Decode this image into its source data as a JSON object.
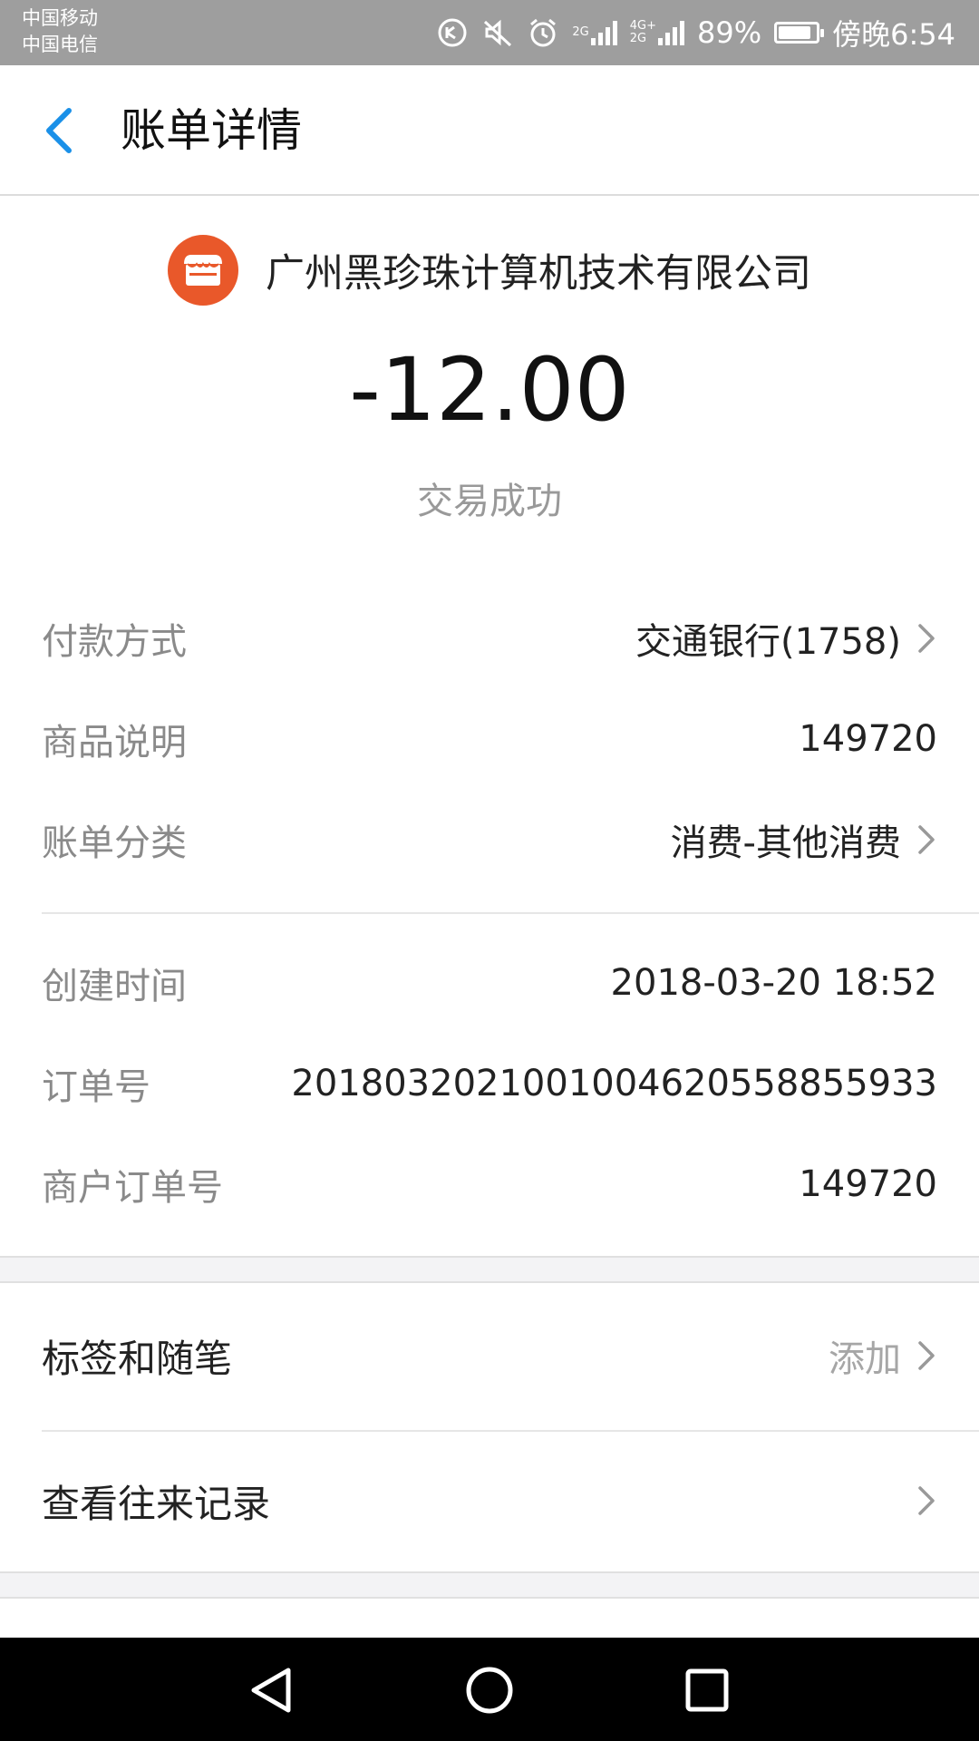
{
  "status_bar": {
    "carrier1": "中国移动",
    "carrier2": "中国电信",
    "net1": "2G",
    "net2_top": "4G+",
    "net2_bottom": "2G",
    "battery": "89%",
    "time": "傍晚6:54"
  },
  "header": {
    "title": "账单详情"
  },
  "merchant": {
    "name": "广州黑珍珠计算机技术有限公司",
    "logo_color": "#e9582a"
  },
  "transaction": {
    "amount": "-12.00",
    "status": "交易成功"
  },
  "details": [
    {
      "label": "付款方式",
      "value": "交通银行(1758)"
    },
    {
      "label": "商品说明",
      "value": "149720"
    },
    {
      "label": "账单分类",
      "value": "消费-其他消费"
    },
    {
      "label": "创建时间",
      "value": "2018-03-20 18:52"
    },
    {
      "label": "订单号",
      "value": "20180320210010046205588559​33"
    },
    {
      "label": "商户订单号",
      "value": "149720"
    }
  ],
  "actions": [
    {
      "label": "标签和随笔",
      "value": "添加"
    },
    {
      "label": "查看往来记录",
      "value": ""
    }
  ],
  "colors": {
    "accent": "#1a90e8",
    "status_bar_bg": "#9e9e9e",
    "label_gray": "#8a8a8a"
  }
}
